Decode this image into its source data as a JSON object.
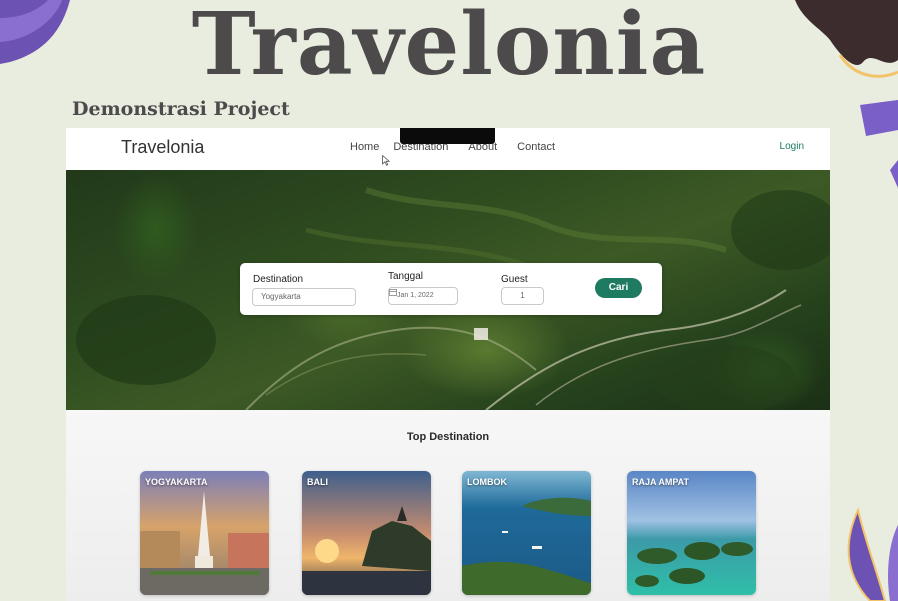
{
  "slide": {
    "title": "Travelonia",
    "subtitle": "Demonstrasi Project"
  },
  "site": {
    "brand": "Travelonia",
    "nav": [
      {
        "label": "Home"
      },
      {
        "label": "Destination"
      },
      {
        "label": "About"
      },
      {
        "label": "Contact"
      }
    ],
    "login_label": "Login",
    "accent_color": "#1f7a62"
  },
  "search": {
    "destination_label": "Destination",
    "destination_value": "Yogyakarta",
    "date_label": "Tanggal",
    "date_value": "Jan 1, 2022",
    "guest_label": "Guest",
    "guest_value": "1",
    "submit_label": "Cari",
    "date_icon": "calendar-icon"
  },
  "top_destination": {
    "title": "Top Destination",
    "cards": [
      {
        "label": "YOGYAKARTA"
      },
      {
        "label": "BALI"
      },
      {
        "label": "LOMBOK"
      },
      {
        "label": "RAJA AMPAT"
      }
    ]
  }
}
